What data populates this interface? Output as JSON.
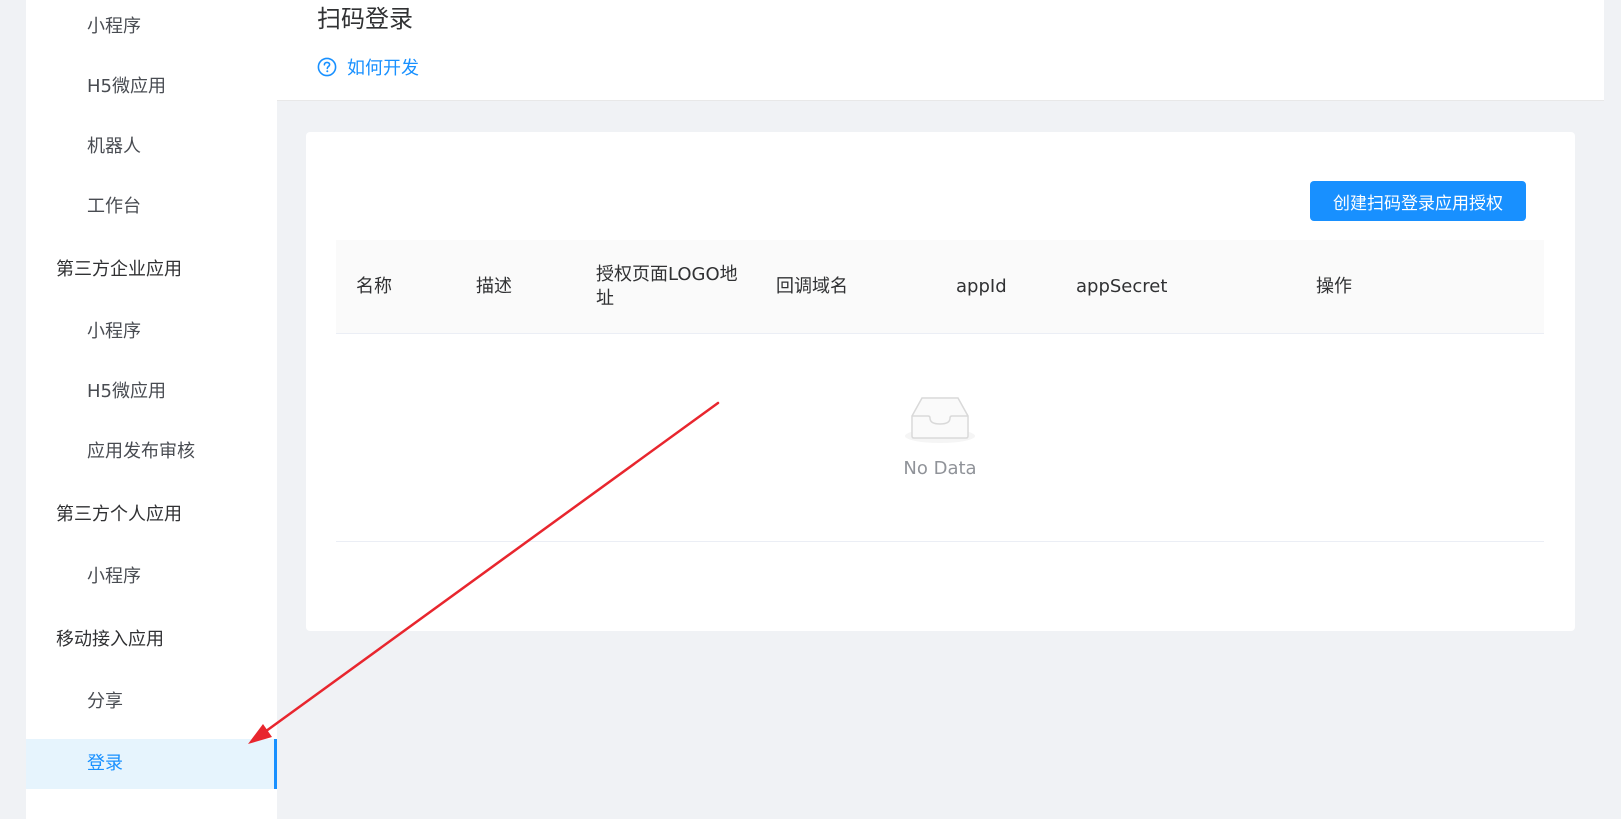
{
  "sidebar": {
    "items": [
      {
        "label": "小程序",
        "type": "sub"
      },
      {
        "label": "H5微应用",
        "type": "sub"
      },
      {
        "label": "机器人",
        "type": "sub"
      },
      {
        "label": "工作台",
        "type": "sub"
      },
      {
        "label": "第三方企业应用",
        "type": "group"
      },
      {
        "label": "小程序",
        "type": "sub"
      },
      {
        "label": "H5微应用",
        "type": "sub"
      },
      {
        "label": "应用发布审核",
        "type": "sub"
      },
      {
        "label": "第三方个人应用",
        "type": "group"
      },
      {
        "label": "小程序",
        "type": "sub"
      },
      {
        "label": "移动接入应用",
        "type": "group"
      },
      {
        "label": "分享",
        "type": "sub"
      },
      {
        "label": "登录",
        "type": "sub",
        "active": true
      }
    ]
  },
  "header": {
    "title": "扫码登录",
    "help_label": "如何开发"
  },
  "toolbar": {
    "create_label": "创建扫码登录应用授权"
  },
  "table": {
    "columns": [
      "名称",
      "描述",
      "授权页面LOGO地址",
      "回调域名",
      "appId",
      "appSecret",
      "操作"
    ],
    "rows": [],
    "empty_text": "No Data"
  },
  "colors": {
    "accent": "#1890ff",
    "active_bg": "#e6f4fd",
    "annotation_arrow": "#e8262e"
  },
  "icons": {
    "help": "question-circle-icon",
    "empty": "empty-inbox-icon"
  }
}
